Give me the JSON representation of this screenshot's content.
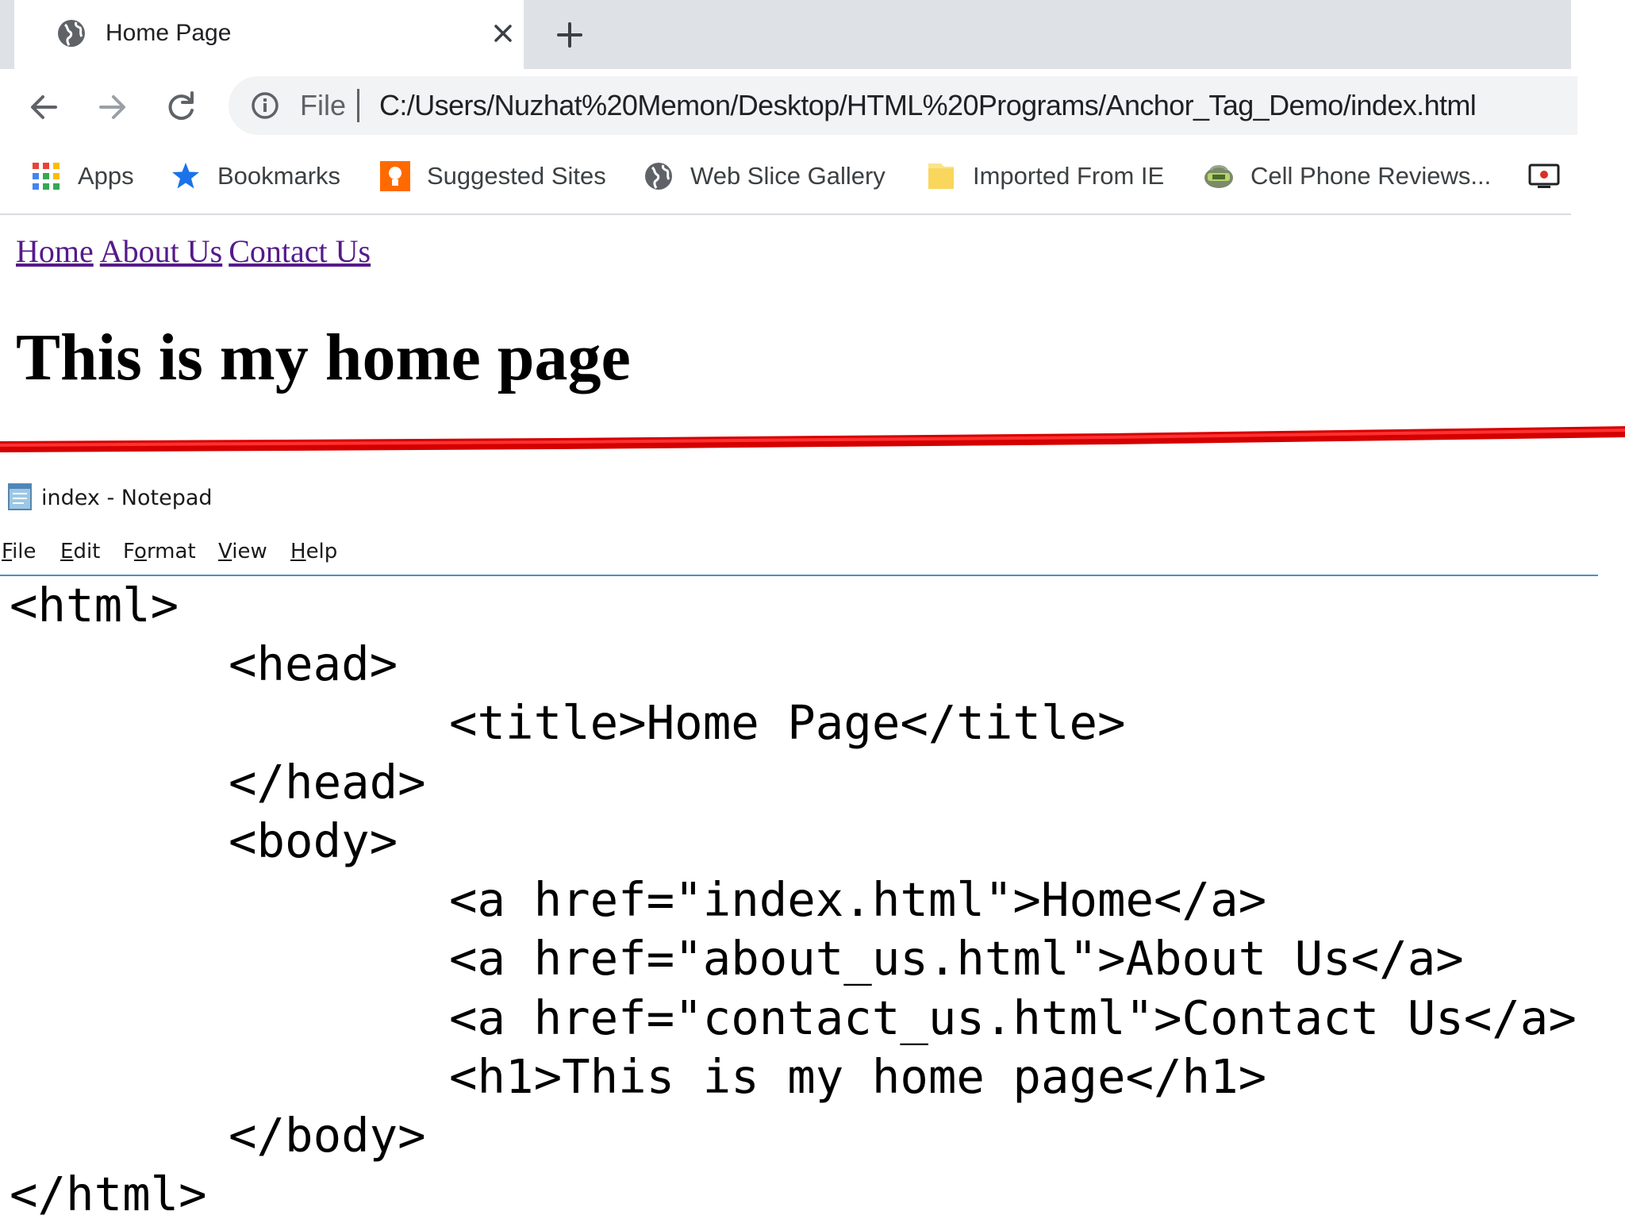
{
  "browser": {
    "tab": {
      "title": "Home Page"
    },
    "address_bar": {
      "scheme_label": "File",
      "url": "C:/Users/Nuzhat%20Memon/Desktop/HTML%20Programs/Anchor_Tag_Demo/index.html"
    },
    "bookmarks": [
      {
        "label": "Apps",
        "icon": "apps-grid-icon"
      },
      {
        "label": "Bookmarks",
        "icon": "star-icon"
      },
      {
        "label": "Suggested Sites",
        "icon": "suggested-sites-icon"
      },
      {
        "label": "Web Slice Gallery",
        "icon": "globe-icon"
      },
      {
        "label": "Imported From IE",
        "icon": "folder-icon"
      },
      {
        "label": "Cell Phone Reviews...",
        "icon": "cell-phone-icon"
      }
    ],
    "page": {
      "links": [
        "Home",
        "About Us",
        "Contact Us"
      ],
      "heading": "This is my home page"
    }
  },
  "notepad": {
    "title": "index - Notepad",
    "menu": [
      "File",
      "Edit",
      "Format",
      "View",
      "Help"
    ],
    "code_lines": [
      "<html>",
      "<head>",
      "<title>Home Page</title>",
      "</head>",
      "<body>",
      "<a href=\"index.html\">Home</a>",
      "<a href=\"about_us.html\">About Us</a>",
      "<a href=\"contact_us.html\">Contact Us</a>",
      "<h1>This is my home page</h1>",
      "</body>",
      "</html>"
    ]
  },
  "colors": {
    "tabstrip": "#dee1e6",
    "omnibox": "#f1f3f4",
    "visited_link": "#551a8b",
    "divider_red": "#e00000",
    "notepad_menu_border": "#4a90c8"
  }
}
